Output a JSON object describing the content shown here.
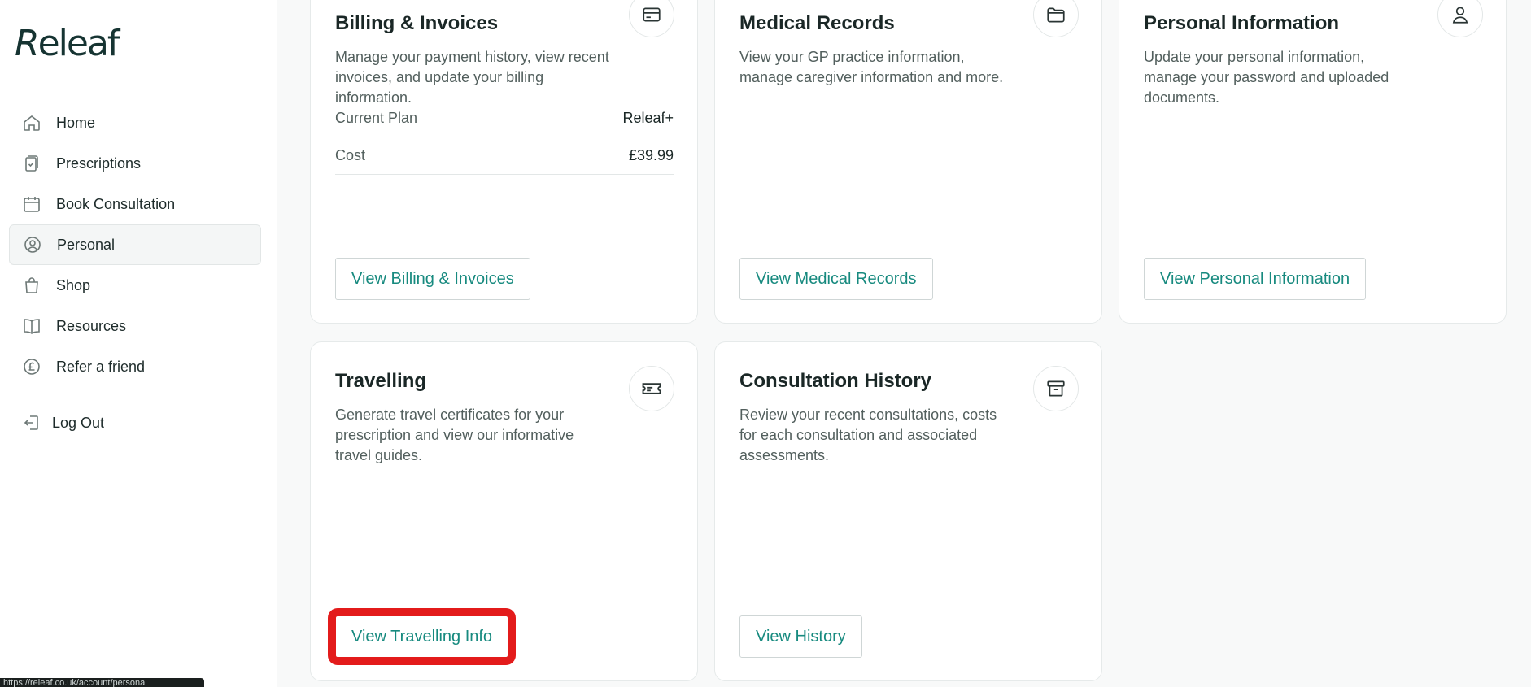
{
  "brand": {
    "name_italic": "R",
    "name_rest": "eleaf"
  },
  "sidebar": {
    "items": [
      {
        "label": "Home",
        "icon": "home-icon",
        "active": false
      },
      {
        "label": "Prescriptions",
        "icon": "prescription-icon",
        "active": false
      },
      {
        "label": "Book Consultation",
        "icon": "calendar-icon",
        "active": false
      },
      {
        "label": "Personal",
        "icon": "user-circle-icon",
        "active": true
      },
      {
        "label": "Shop",
        "icon": "shopping-bag-icon",
        "active": false
      },
      {
        "label": "Resources",
        "icon": "book-icon",
        "active": false
      },
      {
        "label": "Refer a friend",
        "icon": "pound-coin-icon",
        "active": false
      }
    ],
    "logout_label": "Log Out"
  },
  "status_url": "https://releaf.co.uk/account/personal",
  "cards": {
    "billing": {
      "title": "Billing & Invoices",
      "description": "Manage your payment history, view recent invoices, and update your billing information.",
      "rows": [
        {
          "key": "Current Plan",
          "value": "Releaf+"
        },
        {
          "key": "Cost",
          "value": "£39.99"
        }
      ],
      "button": "View Billing & Invoices",
      "icon": "credit-card-icon"
    },
    "medical": {
      "title": "Medical Records",
      "description": "View your GP practice information, manage caregiver information and more.",
      "button": "View Medical Records",
      "icon": "folder-icon"
    },
    "personal": {
      "title": "Personal Information",
      "description": "Update your personal information, manage your password and uploaded documents.",
      "button": "View Personal Information",
      "icon": "user-icon"
    },
    "travelling": {
      "title": "Travelling",
      "description": "Generate travel certificates for your prescription and view our informative travel guides.",
      "button": "View Travelling Info",
      "icon": "ticket-icon"
    },
    "history": {
      "title": "Consultation History",
      "description": "Review your recent consultations, costs for each consultation and associated assessments.",
      "button": "View History",
      "icon": "archive-icon"
    }
  },
  "colors": {
    "accent": "#178a7f",
    "highlight": "#e31b1b",
    "text": "#1a2726"
  }
}
